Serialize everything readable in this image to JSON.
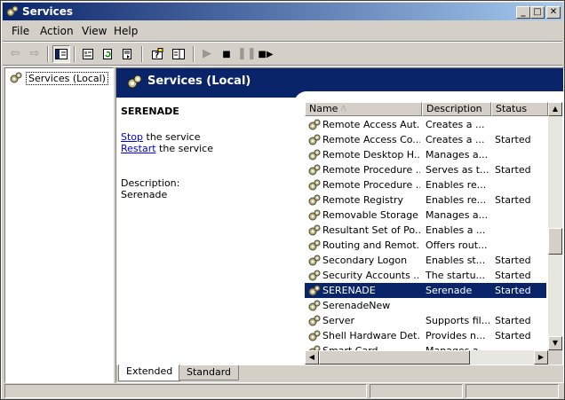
{
  "window": {
    "title": "Services"
  },
  "title_buttons": {
    "minimize": "_",
    "maximize": "□",
    "close": "✕"
  },
  "menu": [
    {
      "label": "File"
    },
    {
      "label": "Action"
    },
    {
      "label": "View"
    },
    {
      "label": "Help"
    }
  ],
  "tree": {
    "root_label": "Services (Local)"
  },
  "pane_header": {
    "title": "Services (Local)"
  },
  "details": {
    "service_name": "SERENADE",
    "stop_link": "Stop",
    "stop_rest": " the service",
    "restart_link": "Restart",
    "restart_rest": " the service",
    "description_label": "Description:",
    "description_value": "Serenade"
  },
  "columns": {
    "name": "Name",
    "sort_indicator": "/\\",
    "description": "Description",
    "status": "Status"
  },
  "services": [
    {
      "name": "Remote Access Aut...",
      "description": "Creates a ...",
      "status": ""
    },
    {
      "name": "Remote Access Co...",
      "description": "Creates a ...",
      "status": "Started"
    },
    {
      "name": "Remote Desktop H...",
      "description": "Manages a...",
      "status": ""
    },
    {
      "name": "Remote Procedure ...",
      "description": "Serves as t...",
      "status": "Started"
    },
    {
      "name": "Remote Procedure ...",
      "description": "Enables re...",
      "status": ""
    },
    {
      "name": "Remote Registry",
      "description": "Enables re...",
      "status": "Started"
    },
    {
      "name": "Removable Storage",
      "description": "Manages a...",
      "status": ""
    },
    {
      "name": "Resultant Set of Po...",
      "description": "Enables a ...",
      "status": ""
    },
    {
      "name": "Routing and Remot...",
      "description": "Offers rout...",
      "status": ""
    },
    {
      "name": "Secondary Logon",
      "description": "Enables st...",
      "status": "Started"
    },
    {
      "name": "Security Accounts ...",
      "description": "The startu...",
      "status": "Started"
    },
    {
      "name": "SERENADE",
      "description": "Serenade",
      "status": "Started",
      "selected": true
    },
    {
      "name": "SerenadeNew",
      "description": "",
      "status": ""
    },
    {
      "name": "Server",
      "description": "Supports fil...",
      "status": "Started"
    },
    {
      "name": "Shell Hardware Det...",
      "description": "Provides n...",
      "status": "Started"
    },
    {
      "name": "Smart Card",
      "description": "Manages a...",
      "status": ""
    }
  ],
  "tabs": [
    {
      "label": "Extended",
      "active": true
    },
    {
      "label": "Standard",
      "active": false
    }
  ],
  "colors": {
    "accent": "#0a246a",
    "chrome": "#d4d0c8",
    "link": "#0000ee"
  }
}
